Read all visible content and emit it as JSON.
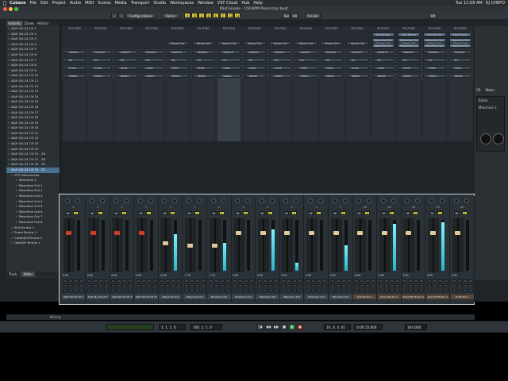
{
  "menubar": {
    "app": "Cubase",
    "items": [
      "File",
      "Edit",
      "Project",
      "Audio",
      "MIDI",
      "Scores",
      "Media",
      "Transport",
      "Studio",
      "Workspaces",
      "Window",
      "VST Cloud",
      "Hub",
      "Help"
    ],
    "clock": "Tue 11:09 AM",
    "user": "DJ CHEPO"
  },
  "window": {
    "title": "MixConsole - 150 BPM Piano trap beat"
  },
  "toolbar": {
    "configurations": "Configurations",
    "racks": "Racks",
    "q_link": "Q-Link",
    "sel": "Sel",
    "all": "All",
    "io": "I/O",
    "buttons_left": [
      "‹",
      "›",
      "‹",
      "›"
    ],
    "yellow_toggles": [
      "A",
      "B",
      "C",
      "D",
      "E",
      "F",
      "G",
      "H"
    ]
  },
  "leftpanel": {
    "tabs": [
      "Visibility",
      "Zones",
      "History"
    ],
    "channels": [
      "A&H QU-24 CH 1",
      "A&H QU-24 CH 2",
      "A&H QU-24 CH 3",
      "A&H QU-24 CH 4",
      "A&H QU-24 CH 5",
      "A&H QU-24 CH 6",
      "A&H QU-24 CH 7",
      "A&H QU-24 CH 8",
      "A&H QU-24 CH 9",
      "A&H QU-24 CH 10",
      "A&H QU-24 CH 11",
      "A&H QU-24 CH 12",
      "A&H QU-24 CH 13",
      "A&H QU-24 CH 14",
      "A&H QU-24 CH 15",
      "A&H QU-24 CH 16",
      "A&H QU-24 CH 17",
      "A&H QU-24 CH 18",
      "A&H QU-24 CH 19",
      "A&H QU-24 CH 20",
      "A&H QU-24 CH 21",
      "A&H QU-24 CH 22",
      "A&H QU-24 CH 23",
      "A&H QU-24 CH 24",
      "A&H QU-24 CH 25 - 26",
      "A&H QU-24 CH 27 - 28",
      "A&H QU-24 CH 29 - 30"
    ],
    "selected": "A&H QU-24 CH 31 - 32",
    "instruments_header": "VST Instruments",
    "instruments": [
      "Maschine 2",
      "Maschine Out 1",
      "Maschine Out 2",
      "Maschine Out 3",
      "Maschine Out 4",
      "Maschine Out 5",
      "Maschine Out 6",
      "Maschine Out 7",
      "Maschine Out 8"
    ],
    "groups": [
      "Kick Brutus 1",
      "Snare Brutus 1",
      "Closed/Hi Brutus 1",
      "Open/Hi Brutus 1"
    ],
    "footer_tabs": [
      "Track",
      "Editor"
    ]
  },
  "routing": {
    "header_label": "ROUTING",
    "routing_count": 16,
    "slot_label": "Stereo Out",
    "inserts_label": "INSERTS",
    "eq_label": "EQ",
    "strip_label": "STRIP",
    "sends_label": "SENDS",
    "kick_sends": [
      "Kick Brutus",
      "Maschine Out",
      "Maschine Out"
    ]
  },
  "mixer": {
    "channels": [
      {
        "name": "A&H QU-24 CH 1",
        "value": "0.00",
        "meter": 0.0,
        "fader": 0.75,
        "handle": "#d33b2f",
        "ms": [
          "M",
          "S"
        ],
        "pan": "C"
      },
      {
        "name": "A&H QU-24 CH 2",
        "value": "0.00",
        "meter": 0.0,
        "fader": 0.75,
        "handle": "#d33b2f",
        "ms": [
          "M",
          "S"
        ],
        "pan": "C"
      },
      {
        "name": "A&H QU-24 CH 3",
        "value": "0.00",
        "meter": 0.0,
        "fader": 0.75,
        "handle": "#d33b2f",
        "ms": [
          "M",
          "S"
        ],
        "pan": "C"
      },
      {
        "name": "A&H QU-24 CH 31",
        "value": "0.00",
        "meter": 0.0,
        "fader": 0.75,
        "handle": "#d33b2f",
        "ms": [
          "M",
          "S"
        ],
        "pan": "C"
      },
      {
        "name": "Maschine Out",
        "value": "-5.00",
        "meter": 0.72,
        "fader": 0.55,
        "handle": "#e0c99a",
        "ms": [
          "M",
          "S"
        ],
        "pan": "C"
      },
      {
        "name": "Maschine Out",
        "value": "-7.75",
        "meter": 0.0,
        "fader": 0.5,
        "handle": "#e0c99a",
        "ms": [
          "M",
          "S"
        ],
        "pan": "C"
      },
      {
        "name": "Maschine Out",
        "value": "-7.75",
        "meter": 0.55,
        "fader": 0.5,
        "handle": "#e0c99a",
        "ms": [
          "M",
          "S"
        ],
        "pan": "C"
      },
      {
        "name": "Maschine Out",
        "value": "0.00",
        "meter": 0.0,
        "fader": 0.75,
        "handle": "#e0c99a",
        "ms": [
          "M",
          "S"
        ],
        "pan": "C"
      },
      {
        "name": "Maschine Out",
        "value": "0.00",
        "meter": 0.82,
        "fader": 0.75,
        "handle": "#e0c99a",
        "ms": [
          "M",
          "S"
        ],
        "pan": "C"
      },
      {
        "name": "Maschine Out",
        "value": "0.00",
        "meter": 0.15,
        "fader": 0.75,
        "handle": "#e0c99a",
        "ms": [
          "M",
          "S"
        ],
        "pan": "C"
      },
      {
        "name": "Maschine Out",
        "value": "0.00",
        "meter": 0.0,
        "fader": 0.75,
        "handle": "#e0c99a",
        "ms": [
          "M",
          "S"
        ],
        "pan": "C"
      },
      {
        "name": "Maschine Out",
        "value": "0.00",
        "meter": 0.5,
        "fader": 0.75,
        "handle": "#e0c99a",
        "ms": [
          "M",
          "S"
        ],
        "pan": "C"
      },
      {
        "name": "Kick Brutus 1",
        "value": "-0.00",
        "meter": 0.0,
        "fader": 0.75,
        "handle": "#e0c99a",
        "ms": [
          "M",
          "S"
        ],
        "pan": "Off"
      },
      {
        "name": "Snare Brutus 1",
        "value": "0.00",
        "meter": 0.92,
        "fader": 0.75,
        "handle": "#e0c99a",
        "ms": [
          "M",
          "S"
        ],
        "pan": "Off"
      },
      {
        "name": "Closed/Hi Brutus 1",
        "value": "0.00",
        "meter": 0.0,
        "fader": 0.75,
        "handle": "#e0c99a",
        "ms": [
          "M",
          "S"
        ],
        "pan": "Off"
      },
      {
        "name": "Open/Hi Brutus 1",
        "value": "0.00",
        "meter": 0.95,
        "fader": 0.75,
        "handle": "#e0c99a",
        "ms": [
          "M",
          "S"
        ],
        "pan": "Off"
      },
      {
        "name": "Hi Brutus 1",
        "value": "0.00",
        "meter": 0.0,
        "fader": 0.75,
        "handle": "#e0c99a",
        "ms": [
          "M",
          "S"
        ],
        "pan": "Off"
      }
    ]
  },
  "rightpanel": {
    "tabs": [
      "CR",
      "Meter"
    ],
    "label1": "Racks",
    "label2": "Maschine 2"
  },
  "statusbar": {
    "left_tab": "Mixing"
  },
  "transport": {
    "position_left": "1. 1. 1.  0",
    "position_right": "100. 1. 1.  0",
    "time": "10. 3. 3. 41",
    "time2": "0:00:15.000",
    "tempo": "164.000",
    "transport_icons": [
      "|◀",
      "◀◀",
      "▶▶",
      "■",
      "▶",
      "●"
    ]
  }
}
